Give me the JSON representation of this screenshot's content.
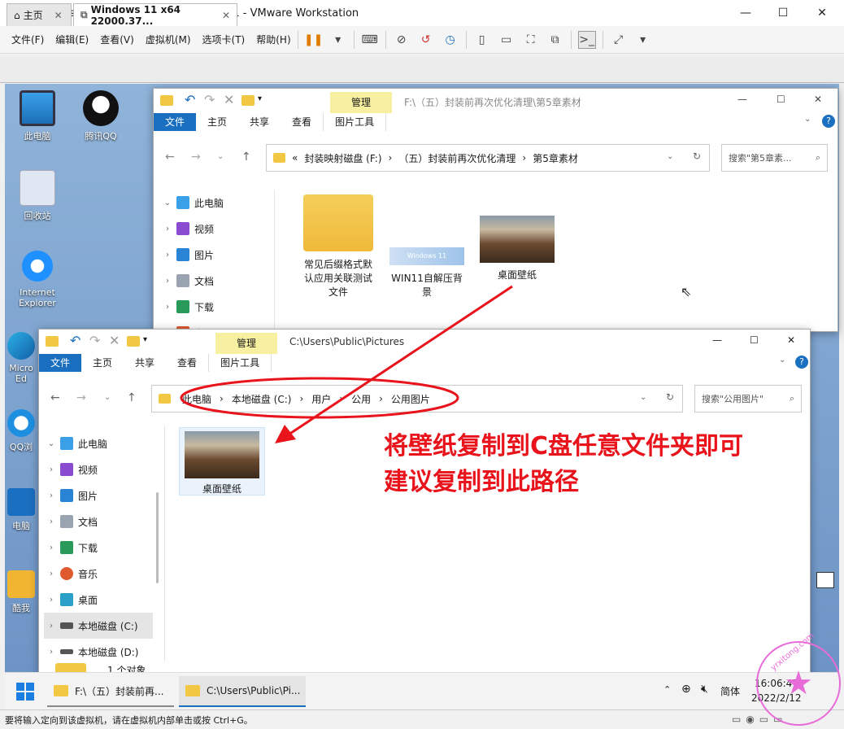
{
  "vmware": {
    "title": "Windows 11 x64 22000.376-2022.01.11 - VMware Workstation",
    "menu": [
      "文件(F)",
      "编辑(E)",
      "查看(V)",
      "虚拟机(M)",
      "选项卡(T)",
      "帮助(H)"
    ],
    "tabs": [
      {
        "label": "主页"
      },
      {
        "label": "Windows 11 x64 22000.37..."
      }
    ],
    "status_text": "要将输入定向到该虚拟机，请在虚拟机内部单击或按 Ctrl+G。"
  },
  "desktop_icons": [
    {
      "label": "此电脑"
    },
    {
      "label": "腾讯QQ"
    },
    {
      "label": "回收站"
    },
    {
      "label": "Internet Explorer"
    },
    {
      "label": "Micro Ed"
    },
    {
      "label": "QQ浏"
    },
    {
      "label": "电脑"
    },
    {
      "label": "酷我"
    }
  ],
  "explorer_back": {
    "title_path": "F:\\（五）封装前再次优化清理\\第5章素材",
    "ribbon_tabs": [
      "文件",
      "主页",
      "共享",
      "查看"
    ],
    "manage_label": "管理",
    "picture_tools": "图片工具",
    "address": [
      "«",
      "封装映射磁盘 (F:)",
      "›",
      "（五）封装前再次优化清理",
      "›",
      "第5章素材"
    ],
    "search_placeholder": "搜索\"第5章素...",
    "nav": [
      "此电脑",
      "视频",
      "图片",
      "文档",
      "下载",
      "音乐"
    ],
    "files": [
      {
        "name": "常见后缀格式默认应用关联测试文件"
      },
      {
        "name": "WIN11自解压背景",
        "thumb_text": "Windows 11"
      },
      {
        "name": "桌面壁纸"
      }
    ]
  },
  "explorer_front": {
    "title_path": "C:\\Users\\Public\\Pictures",
    "ribbon_tabs": [
      "文件",
      "主页",
      "共享",
      "查看"
    ],
    "manage_label": "管理",
    "picture_tools": "图片工具",
    "address": [
      "此电脑",
      "›",
      "本地磁盘 (C:)",
      "›",
      "用户",
      "›",
      "公用",
      "›",
      "公用图片"
    ],
    "search_placeholder": "搜索\"公用图片\"",
    "nav": [
      "此电脑",
      "视频",
      "图片",
      "文档",
      "下载",
      "音乐",
      "桌面",
      "本地磁盘 (C:)",
      "本地磁盘 (D:)"
    ],
    "files": [
      {
        "name": "桌面壁纸"
      }
    ],
    "status": "1 个对象"
  },
  "annotation": {
    "line1": "将壁纸复制到C盘任意文件夹即可",
    "line2": "建议复制到此路径",
    "color": "#e8131b"
  },
  "taskbar": {
    "items": [
      {
        "label": "F:\\（五）封装前再..."
      },
      {
        "label": "C:\\Users\\Public\\Pi..."
      }
    ],
    "ime": "简体",
    "time": "16:06:47",
    "date": "2022/2/12"
  },
  "watermark": "yrxitong.com"
}
